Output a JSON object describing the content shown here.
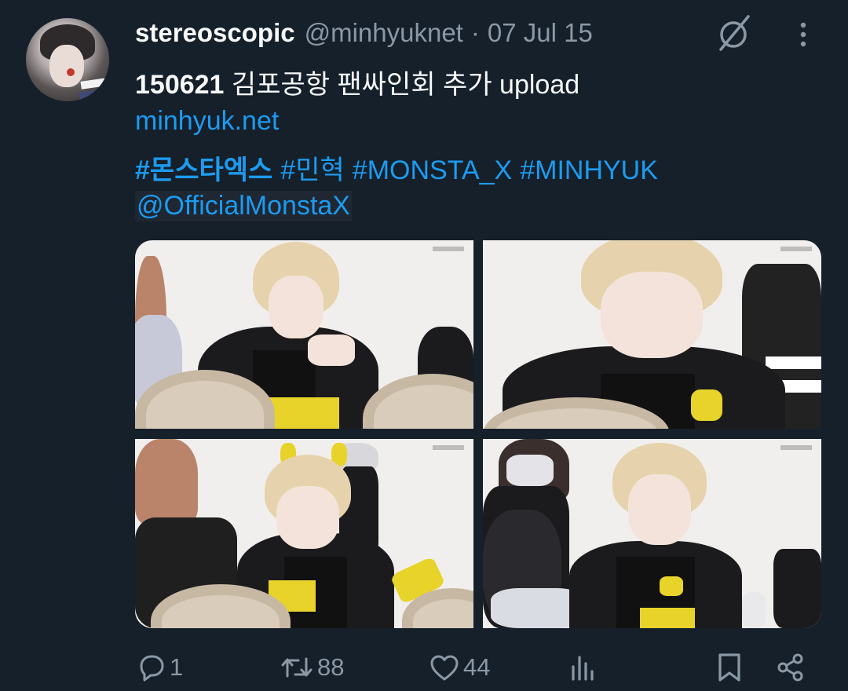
{
  "tweet": {
    "author_name": "stereoscopic",
    "author_handle": "@minhyuknet",
    "separator": "·",
    "date": "07 Jul 15",
    "line1_bold": "150621",
    "line1_rest": " 김포공항 팬싸인회 추가 upload",
    "link": "minhyuk.net",
    "hashtags": [
      "#몬스타엑스",
      "#민혁",
      "#MONSTA_X",
      "#MINHYUK"
    ],
    "mention": "@OfficialMonstaX"
  },
  "actions": {
    "reply_count": "1",
    "retweet_count": "88",
    "like_count": "44"
  },
  "colors": {
    "background": "#15202b",
    "link": "#1d9bf0",
    "muted": "#8b98a5",
    "text": "#f7f9f9"
  },
  "icons": [
    "avatar",
    "no-sign-icon",
    "more-icon",
    "reply-icon",
    "retweet-icon",
    "like-icon",
    "views-icon",
    "bookmark-icon",
    "share-icon"
  ]
}
